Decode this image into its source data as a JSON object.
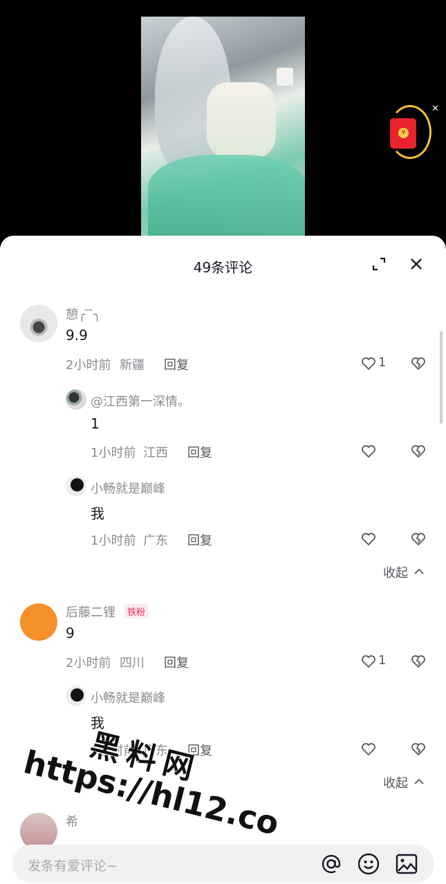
{
  "sheet": {
    "title": "49条评论"
  },
  "comments": [
    {
      "name": "憩╭︎ ̄ ̄╮",
      "text": "9.9",
      "time": "2小时前",
      "location": "新疆",
      "reply_label": "回复",
      "like_count": "1",
      "replies": [
        {
          "name": "@江西第一深情。",
          "text": "1",
          "time": "1小时前",
          "location": "江西",
          "reply_label": "回复"
        },
        {
          "name": "小畅就是巅峰",
          "text": "我",
          "time": "1小时前",
          "location": "广东",
          "reply_label": "回复"
        }
      ],
      "collapse_label": "收起"
    },
    {
      "name": "后藤二锂",
      "badge": "铁粉",
      "text": "9",
      "time": "2小时前",
      "location": "四川",
      "reply_label": "回复",
      "like_count": "1",
      "replies": [
        {
          "name": "小畅就是巅峰",
          "text": "我",
          "time": "1小时前",
          "location": "广东",
          "reply_label": "回复"
        }
      ],
      "collapse_label": "收起"
    },
    {
      "name": "希"
    }
  ],
  "input": {
    "placeholder": "发条有爱评论~"
  },
  "watermark": {
    "line1": "黑料网",
    "line2": "https://hl12.co"
  },
  "icons": {
    "expand": "expand-icon",
    "close": "close-icon",
    "like": "heart-icon",
    "dislike": "broken-heart-icon",
    "at": "at-icon",
    "emoji": "emoji-icon",
    "image": "image-icon",
    "red_packet": "red-packet-icon"
  },
  "colors": {
    "accent_badge": "#e1345b",
    "red_packet": "#e8232e"
  }
}
